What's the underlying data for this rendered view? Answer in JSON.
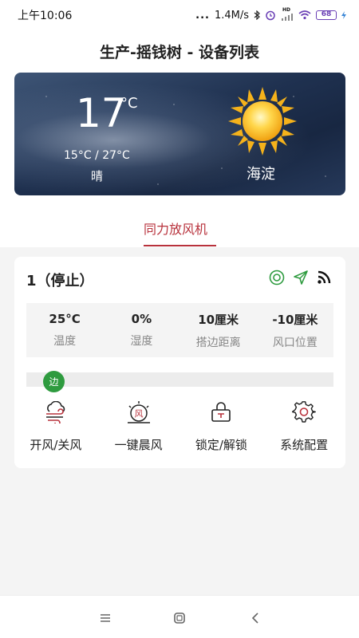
{
  "status_bar": {
    "time": "上午10:06",
    "dots": "...",
    "speed": "1.4M/s",
    "hd": "HD",
    "battery": "68"
  },
  "header": {
    "title": "生产-摇钱树 - 设备列表"
  },
  "weather": {
    "temperature": "17",
    "unit": "°C",
    "range": "15°C / 27°C",
    "description": "晴",
    "city": "海淀"
  },
  "tabs": [
    {
      "label": "同力放风机",
      "active": true
    }
  ],
  "device": {
    "name": "1（停止）",
    "metrics": [
      {
        "value": "25°C",
        "label": "温度"
      },
      {
        "value": "0%",
        "label": "湿度"
      },
      {
        "value": "10厘米",
        "label": "搭边距离"
      },
      {
        "value": "-10厘米",
        "label": "风口位置"
      }
    ],
    "progress_badge": "边",
    "actions": [
      {
        "label": "开风/关风",
        "icon": "wind-cloud-icon"
      },
      {
        "label": "一键晨风",
        "icon": "morning-wind-icon"
      },
      {
        "label": "锁定/解锁",
        "icon": "lock-icon"
      },
      {
        "label": "系统配置",
        "icon": "gear-icon"
      }
    ]
  },
  "colors": {
    "accent": "#b8323c",
    "status_ok": "#2e9b3f",
    "icon_green": "#2e9b3f"
  }
}
